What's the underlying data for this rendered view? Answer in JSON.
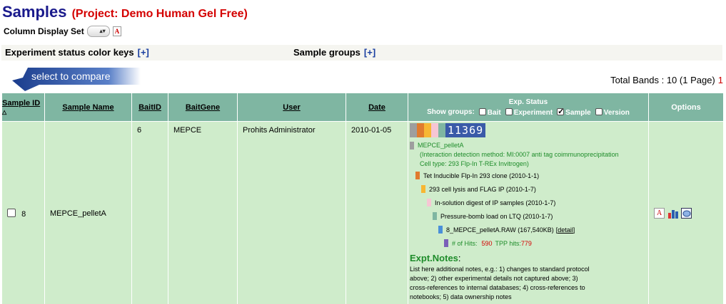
{
  "header": {
    "title": "Samples",
    "project": "(Project: Demo Human Gel Free)"
  },
  "column_display": {
    "label": "Column Display Set",
    "selected": ""
  },
  "bars": {
    "status_keys": {
      "label": "Experiment status color keys",
      "toggle": "[+]"
    },
    "sample_groups": {
      "label": "Sample groups",
      "toggle": "[+]"
    }
  },
  "compare": {
    "label": "select to compare"
  },
  "total": {
    "text": "Total Bands : 10 (1 Page)",
    "page": "1"
  },
  "table": {
    "columns": {
      "sample_id": "Sample ID",
      "sample_name": "Sample Name",
      "bait_id": "BaitID",
      "bait_gene": "BaitGene",
      "user": "User",
      "date": "Date",
      "exp_status": "Exp. Status",
      "show_groups": "Show groups:",
      "options": "Options"
    },
    "groups": [
      {
        "label": "Bait",
        "checked": false
      },
      {
        "label": "Experiment",
        "checked": false
      },
      {
        "label": "Sample",
        "checked": true
      },
      {
        "label": "Version",
        "checked": false
      }
    ],
    "row": {
      "sample_id": "8",
      "sample_name": "MEPCE_pelletA",
      "bait_id": "6",
      "bait_gene": "MEPCE",
      "user": "Prohits Administrator",
      "date": "2010-01-05",
      "status_strip": {
        "colors": [
          "#9e9e9e",
          "#e07b2e",
          "#f7b733",
          "#f6c6d4",
          "#7fb6a2",
          "#4a90d9",
          "#7a60b8"
        ],
        "number": "11369"
      },
      "sample_link": "MEPCE_pelletA",
      "detection": "(Interaction detection method: MI:0007 anti tag coimmunoprecipitation",
      "cell_type": "Cell type: 293 Flp-In T-REx Invitrogen)",
      "steps": [
        {
          "text": "Tet Inducible Flp-In 293 clone (2010-1-1)",
          "color": "#e07b2e"
        },
        {
          "text": "293 cell lysis and FLAG IP (2010-1-7)",
          "color": "#f7b733"
        },
        {
          "text": "In-solution digest of IP samples (2010-1-7)",
          "color": "#f6c6d4"
        },
        {
          "text": "Pressure-bomb load on LTQ (2010-1-7)",
          "color": "#7fb6a2"
        }
      ],
      "raw_file": "8_MEPCE_pelletA.RAW (167,540KB)",
      "detail": "[detail]",
      "hits_label": "# of Hits:",
      "hits": "590",
      "tpp_label": "TPP hits:",
      "tpp": "779",
      "notes_title": "Expt.Notes",
      "notes_colon": ":",
      "notes": "List here additional notes, e.g.: 1) changes to standard protocol above; 2) other experimental details not captured above; 3) cross-references to internal databases; 4) cross-references to notebooks; 5) data ownership notes"
    },
    "option_icons": [
      "pdf-report-icon",
      "bar-chart-icon",
      "comment-icon"
    ]
  }
}
